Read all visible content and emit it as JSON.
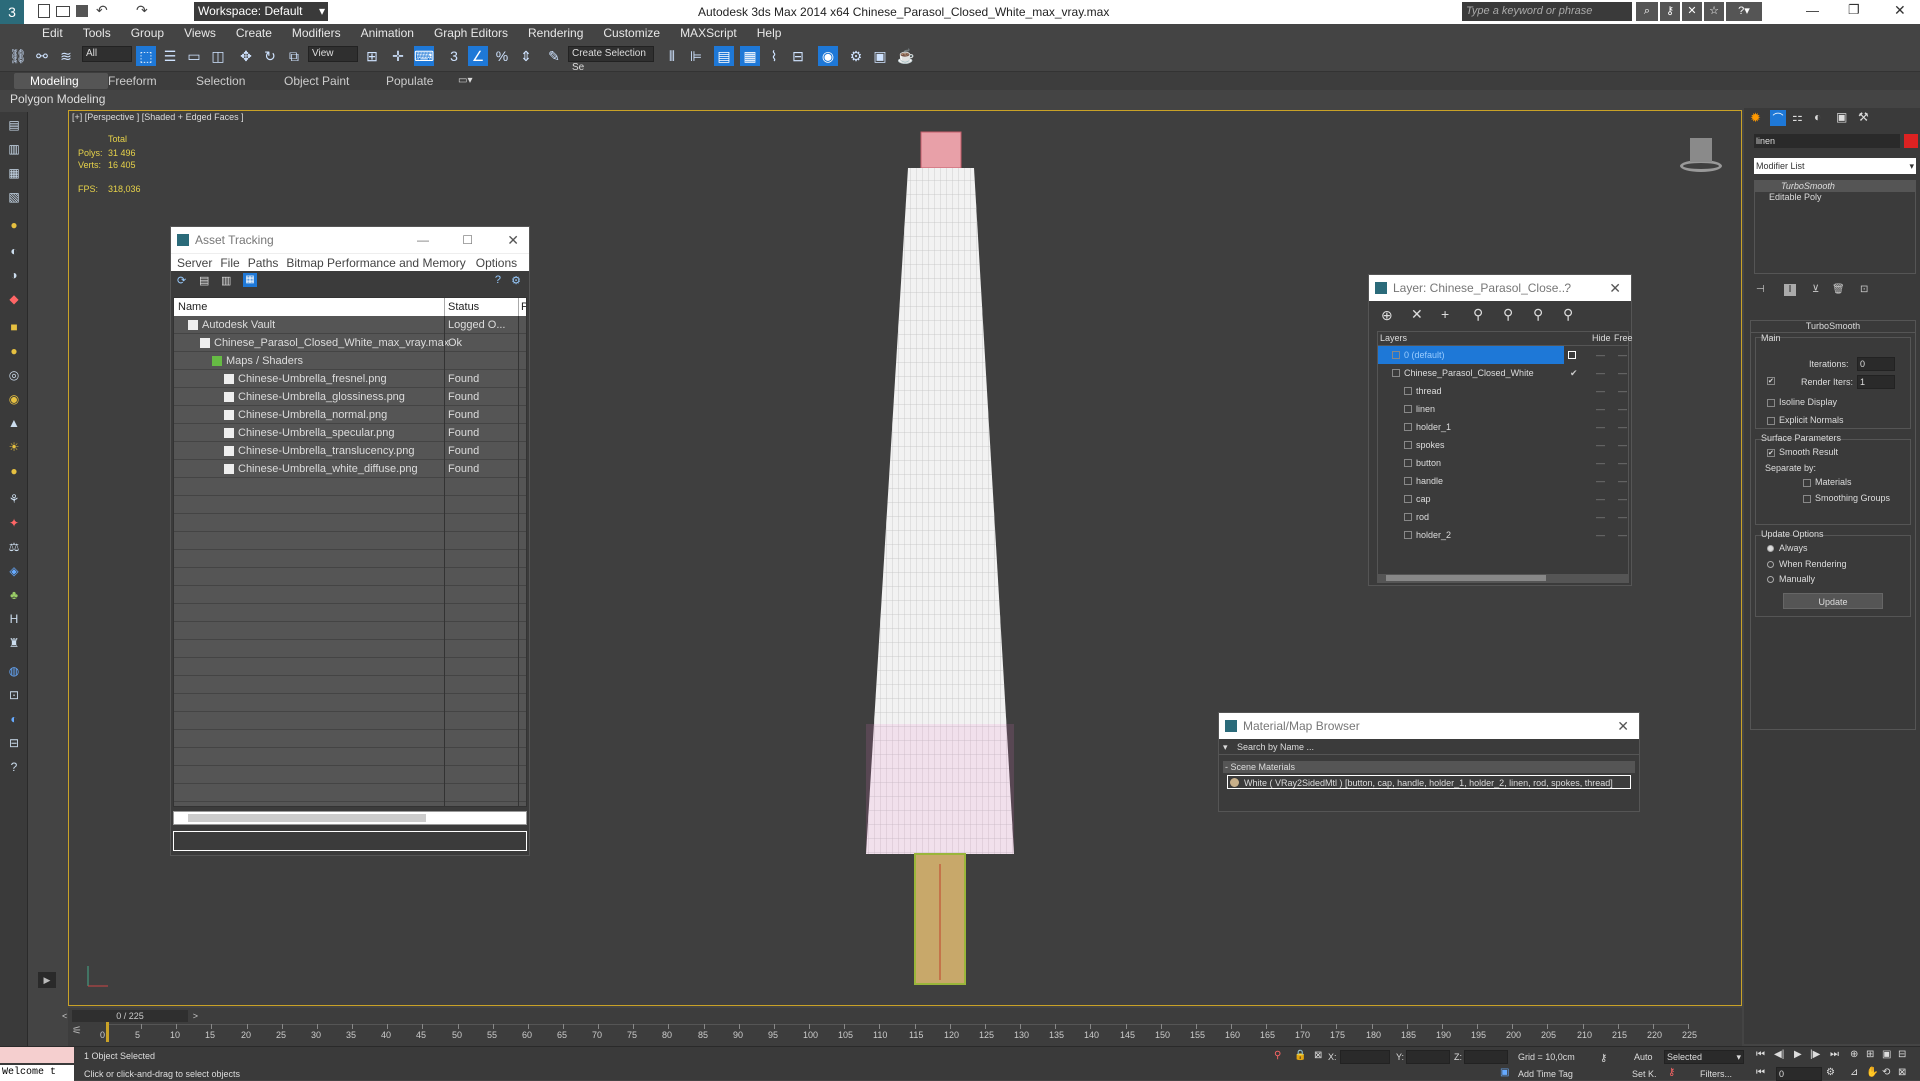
{
  "title": "Autodesk 3ds Max  2014 x64     Chinese_Parasol_Closed_White_max_vray.max",
  "workspace": "Workspace: Default",
  "search_placeholder": "Type a keyword or phrase",
  "menu": [
    "Edit",
    "Tools",
    "Group",
    "Views",
    "Create",
    "Modifiers",
    "Animation",
    "Graph Editors",
    "Rendering",
    "Customize",
    "MAXScript",
    "Help"
  ],
  "toolbar": {
    "filter": "All",
    "view": "View",
    "selset": "Create Selection Se"
  },
  "ribbon": {
    "tabs": [
      "Modeling",
      "Freeform",
      "Selection",
      "Object Paint",
      "Populate"
    ],
    "sub": "Polygon Modeling"
  },
  "viewport": {
    "label": "[+] [Perspective ] [Shaded + Edged Faces ]",
    "total": "Total",
    "polys_l": "Polys:",
    "polys_v": "31 496",
    "verts_l": "Verts:",
    "verts_v": "16 405",
    "fps_l": "FPS:",
    "fps_v": "318,036"
  },
  "asset": {
    "title": "Asset Tracking",
    "menu": [
      "Server",
      "File",
      "Paths",
      "Bitmap Performance and Memory",
      "Options"
    ],
    "cols": [
      "Name",
      "Status",
      "P"
    ],
    "rows": [
      {
        "name": "Autodesk Vault",
        "status": "Logged O...",
        "ind": 0
      },
      {
        "name": "Chinese_Parasol_Closed_White_max_vray.max",
        "status": "Ok",
        "ind": 1
      },
      {
        "name": "Maps / Shaders",
        "status": "",
        "ind": 2
      },
      {
        "name": "Chinese-Umbrella_fresnel.png",
        "status": "Found",
        "ind": 3
      },
      {
        "name": "Chinese-Umbrella_glossiness.png",
        "status": "Found",
        "ind": 3
      },
      {
        "name": "Chinese-Umbrella_normal.png",
        "status": "Found",
        "ind": 3
      },
      {
        "name": "Chinese-Umbrella_specular.png",
        "status": "Found",
        "ind": 3
      },
      {
        "name": "Chinese-Umbrella_translucency.png",
        "status": "Found",
        "ind": 3
      },
      {
        "name": "Chinese-Umbrella_white_diffuse.png",
        "status": "Found",
        "ind": 3
      }
    ]
  },
  "layer": {
    "title": "Layer: Chinese_Parasol_Close...",
    "help": "?",
    "cols": [
      "Layers",
      "Hide",
      "Free"
    ],
    "rows": [
      "0 (default)",
      "Chinese_Parasol_Closed_White",
      "thread",
      "linen",
      "holder_1",
      "spokes",
      "button",
      "handle",
      "cap",
      "rod",
      "holder_2"
    ]
  },
  "material": {
    "title": "Material/Map Browser",
    "search": "Search by Name ...",
    "section": "- Scene Materials",
    "item": "White  ( VRay2SidedMtl )  [button, cap, handle, holder_1, holder_2, linen, rod, spokes, thread]"
  },
  "cmd": {
    "name": "linen",
    "modlist": "Modifier List",
    "stack": [
      "TurboSmooth",
      "Editable Poly"
    ],
    "rollout": "TurboSmooth",
    "main": "Main",
    "iter_l": "Iterations:",
    "iter_v": "0",
    "render_l": "Render Iters:",
    "render_v": "1",
    "isoline": "Isoline Display",
    "explicit": "Explicit Normals",
    "surface": "Surface Parameters",
    "smooth": "Smooth Result",
    "separate": "Separate by:",
    "materials": "Materials",
    "smoothing": "Smoothing Groups",
    "update_opts": "Update Options",
    "always": "Always",
    "when": "When Rendering",
    "manually": "Manually",
    "update": "Update"
  },
  "timeline": {
    "frame": "0 / 225",
    "ticks": [
      "0",
      "5",
      "10",
      "15",
      "20",
      "25",
      "30",
      "35",
      "40",
      "45",
      "50",
      "55",
      "60",
      "65",
      "70",
      "75",
      "80",
      "85",
      "90",
      "95",
      "100",
      "105",
      "110",
      "115",
      "120",
      "125",
      "130",
      "135",
      "140",
      "145",
      "150",
      "155",
      "160",
      "165",
      "170",
      "175",
      "180",
      "185",
      "190",
      "195",
      "200",
      "205",
      "210",
      "215",
      "220",
      "225"
    ]
  },
  "status": {
    "welcome": "Welcome t",
    "selected": "1 Object Selected",
    "hint": "Click or click-and-drag to select objects",
    "x": "X:",
    "y": "Y:",
    "z": "Z:",
    "grid": "Grid = 10,0cm",
    "auto": "Auto",
    "sel": "Selected",
    "addtag": "Add Time Tag",
    "setk": "Set K.",
    "filters": "Filters...",
    "frame": "0"
  },
  "colors": {
    "accent": "#1e78d7",
    "viewport_border": "#c9a227",
    "umbrella": "#f2f2f2",
    "pink": "#e879c8",
    "handle": "#c8a86a"
  }
}
